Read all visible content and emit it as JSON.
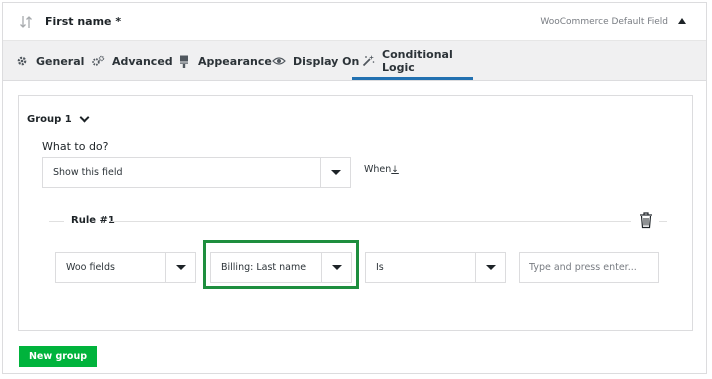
{
  "field_header": {
    "title": "First name *",
    "type_label": "WooCommerce Default Field"
  },
  "tabs": [
    {
      "label": "General",
      "icon": "gear-icon"
    },
    {
      "label": "Advanced",
      "icon": "gears-icon"
    },
    {
      "label": "Appearance",
      "icon": "paint-brush-icon"
    },
    {
      "label": "Display On",
      "icon": "eye-icon"
    },
    {
      "label": "Conditional Logic",
      "icon": "magic-wand-icon",
      "active": true
    }
  ],
  "group": {
    "label": "Group 1",
    "what_to_do_label": "What to do?",
    "action_value": "Show this field",
    "when_label": "When",
    "when_icon": "sort-arrow-icon"
  },
  "rule": {
    "label": "Rule #1",
    "source_value": "Woo fields",
    "field_value": "Billing: Last name",
    "operator_value": "Is",
    "value_placeholder": "Type and press enter..."
  },
  "new_group_label": "New group",
  "colors": {
    "accent": "#2271b1",
    "highlight_border": "#1e8e3e",
    "button": "#00b33c"
  }
}
